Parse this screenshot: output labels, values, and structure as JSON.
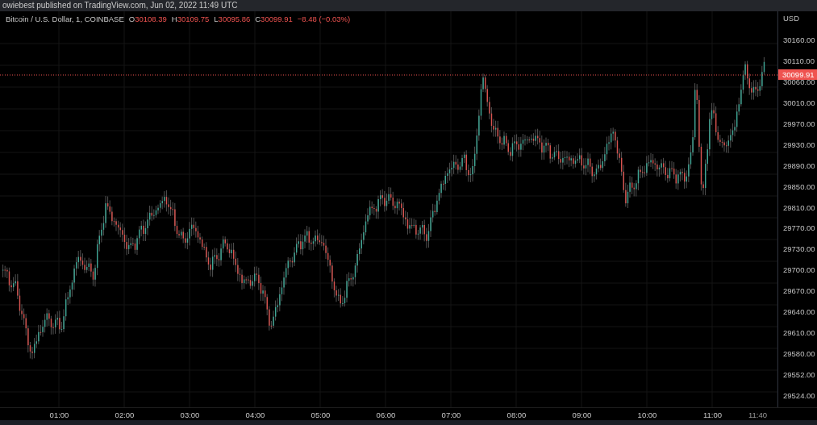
{
  "header": {
    "text": "owiebest published on TradingView.com, Jun 02, 2022 11:49 UTC"
  },
  "legend": {
    "symbol": "Bitcoin / U.S. Dollar, 1, COINBASE",
    "falling": true,
    "ohlc": [
      {
        "label": "O",
        "value": "30108.39"
      },
      {
        "label": "H",
        "value": "30109.75"
      },
      {
        "label": "L",
        "value": "30095.86"
      },
      {
        "label": "C",
        "value": "30099.91"
      }
    ],
    "change": "−8.48 (−0.03%)"
  },
  "price_axis": {
    "currency": "USD",
    "ticks": [
      "30160.00",
      "30110.00",
      "30060.00",
      "30010.00",
      "29970.00",
      "29930.00",
      "29890.00",
      "29850.00",
      "29810.00",
      "29770.00",
      "29730.00",
      "29700.00",
      "29670.00",
      "29640.00",
      "29610.00",
      "29580.00",
      "29552.00",
      "29524.00"
    ],
    "last_price": {
      "label": "30099.91",
      "falling": true
    }
  },
  "time_axis": {
    "ticks": [
      "01:00",
      "02:00",
      "03:00",
      "04:00",
      "05:00",
      "06:00",
      "07:00",
      "08:00",
      "09:00",
      "10:00",
      "11:00",
      "11:40"
    ]
  }
}
